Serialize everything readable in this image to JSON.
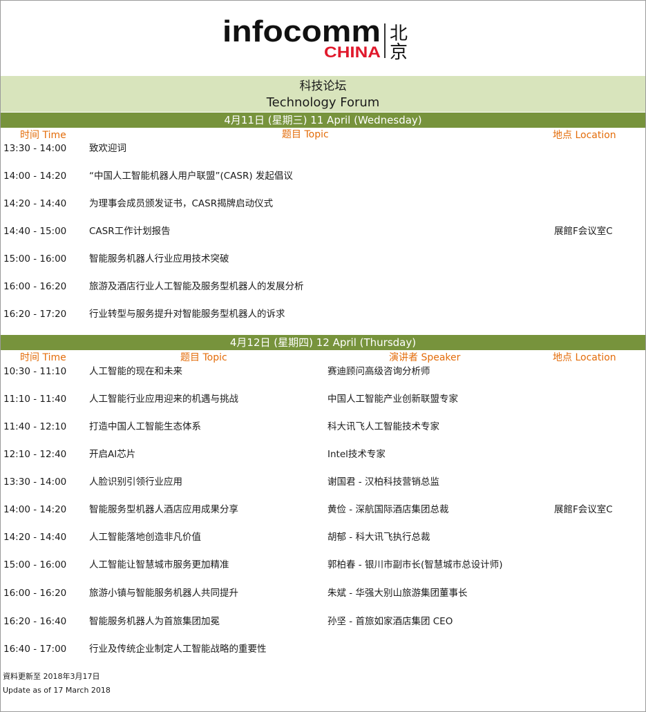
{
  "logo": {
    "word": "infocomm",
    "sub": "CHINA",
    "city": [
      "北",
      "京"
    ]
  },
  "title": {
    "zh": "科技论坛",
    "en": "Technology Forum"
  },
  "day1": {
    "banner": "4月11日 (星期三) 11 April (Wednesday)",
    "headers": {
      "time": "时间 Time",
      "topic": "题目 Topic",
      "location": "地点 Location"
    },
    "rows": [
      {
        "time": "13:30 - 14:00",
        "topic": "致欢迎词",
        "location": ""
      },
      {
        "time": "14:00 - 14:20",
        "topic": "“中国人工智能机器人用户联盟”(CASR) 发起倡议",
        "location": ""
      },
      {
        "time": "14:20 - 14:40",
        "topic": "为理事会成员颁发证书，CASR揭牌启动仪式",
        "location": ""
      },
      {
        "time": "14:40 - 15:00",
        "topic": "CASR工作计划报告",
        "location": "展館F会议室C"
      },
      {
        "time": "15:00 - 16:00",
        "topic": "智能服务机器人行业应用技术突破",
        "location": ""
      },
      {
        "time": "16:00 - 16:20",
        "topic": "旅游及酒店行业人工智能及服务型机器人的发展分析",
        "location": ""
      },
      {
        "time": "16:20 - 17:20",
        "topic": "行业转型与服务提升对智能服务型机器人的诉求",
        "location": ""
      }
    ]
  },
  "day2": {
    "banner": "4月12日 (星期四) 12 April (Thursday)",
    "headers": {
      "time": "时间 Time",
      "topic": "题目 Topic",
      "speaker": "演讲者 Speaker",
      "location": "地点 Location"
    },
    "rows": [
      {
        "time": "10:30 - 11:10",
        "topic": "人工智能的现在和未来",
        "speaker": "赛迪顾问高级咨询分析师",
        "location": ""
      },
      {
        "time": "11:10 - 11:40",
        "topic": "人工智能行业应用迎来的机遇与挑战",
        "speaker": "中国人工智能产业创新联盟专家",
        "location": ""
      },
      {
        "time": "11:40 - 12:10",
        "topic": "打造中国人工智能生态体系",
        "speaker": "科大讯飞人工智能技术专家",
        "location": ""
      },
      {
        "time": "12:10 - 12:40",
        "topic": "开启AI芯片",
        "speaker": "Intel技术专家",
        "location": ""
      },
      {
        "time": "13:30 - 14:00",
        "topic": "人脸识别引领行业应用",
        "speaker": "谢国君 - 汉柏科技营销总监",
        "location": ""
      },
      {
        "time": "14:00 - 14:20",
        "topic": "智能服务型机器人酒店应用成果分享",
        "speaker": "黄俭 - 深航国际酒店集团总裁",
        "location": "展館F会议室C"
      },
      {
        "time": "14:20 - 14:40",
        "topic": "人工智能落地创造非凡价值",
        "speaker": "胡郁 - 科大讯飞执行总裁",
        "location": ""
      },
      {
        "time": "15:00 - 16:00",
        "topic": "人工智能让智慧城市服务更加精准",
        "speaker": "郭柏春 - 银川市副市长(智慧城市总设计师)",
        "location": ""
      },
      {
        "time": "16:00 - 16:20",
        "topic": "旅游小镇与智能服务机器人共同提升",
        "speaker": "朱斌 - 华强大别山旅游集团董事长",
        "location": ""
      },
      {
        "time": "16:20 - 16:40",
        "topic": "智能服务机器人为首旅集团加冕",
        "speaker": "孙坚 - 首旅如家酒店集团 CEO",
        "location": ""
      },
      {
        "time": "16:40 - 17:00",
        "topic": "行业及传统企业制定人工智能战略的重要性",
        "speaker": "",
        "location": ""
      }
    ]
  },
  "footer": {
    "zh": "資料更新至 2018年3月17日",
    "en": "Update as of 17 March 2018"
  },
  "colors": {
    "band_light": "#d8e4bc",
    "band_dark": "#77933c",
    "header_orange": "#e36c09",
    "logo_red": "#e0192c"
  }
}
